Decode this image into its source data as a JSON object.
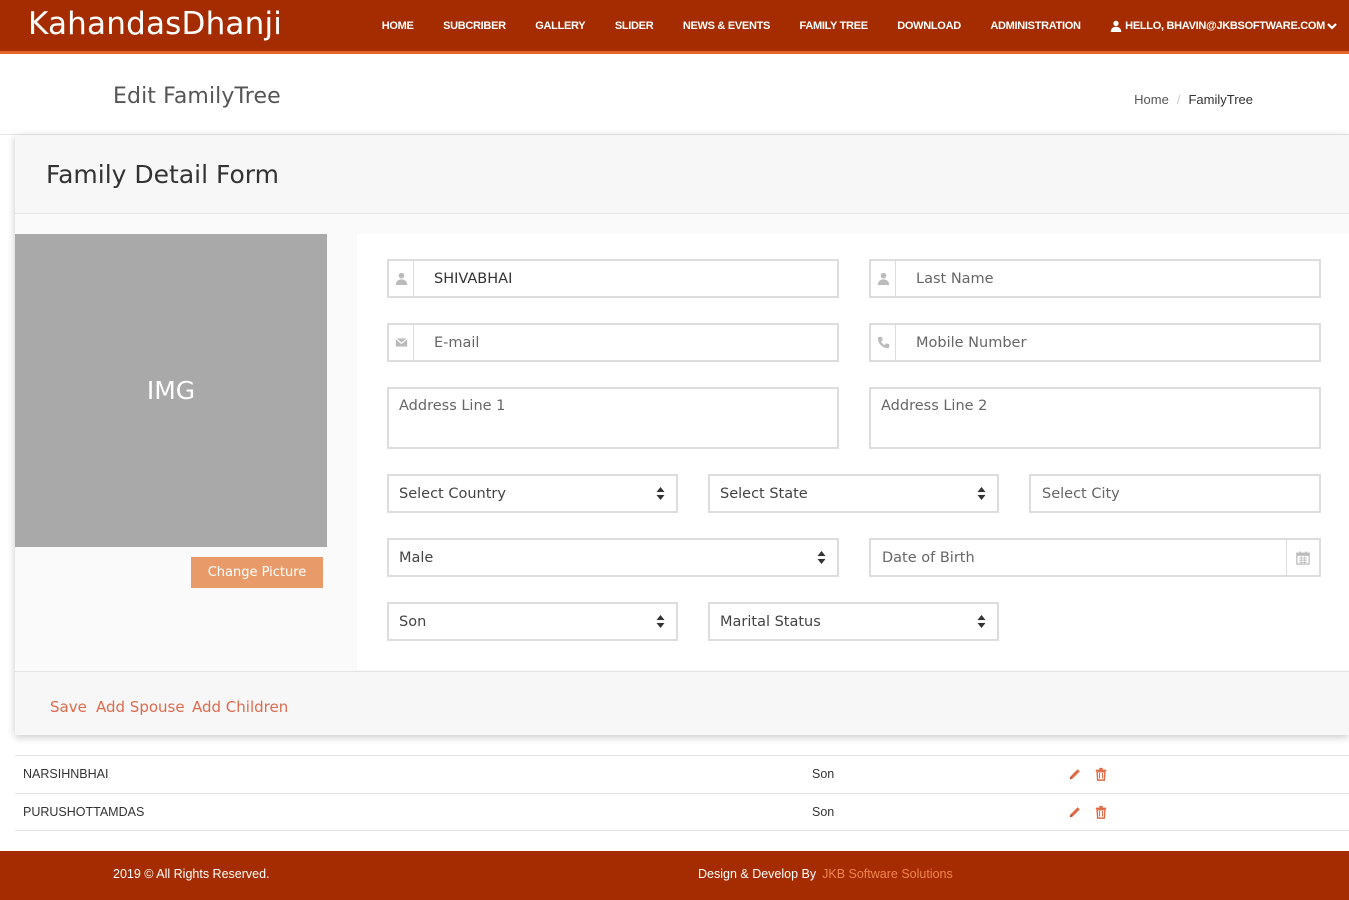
{
  "navbar": {
    "brand": "KahandasDhanji",
    "items": [
      "HOME",
      "SUBCRIBER",
      "GALLERY",
      "SLIDER",
      "NEWS & EVENTS",
      "FAMILY TREE",
      "DOWNLOAD",
      "ADMINISTRATION"
    ],
    "user_label": "HELLO, BHAVIN@JKBSOFTWARE.COM",
    "user_icon": "user-icon",
    "user_chevron_icon": "chevron-down-icon"
  },
  "page_header": {
    "title": "Edit FamilyTree",
    "breadcrumb": {
      "home": "Home",
      "separator": "/",
      "current": "FamilyTree"
    }
  },
  "form": {
    "title": "Family Detail Form",
    "photo_placeholder": "IMG",
    "change_picture": "Change Picture",
    "first_name": {
      "value": "SHIVABHAI",
      "icon": "user-icon"
    },
    "last_name": {
      "value": "",
      "placeholder": "Last Name",
      "icon": "user-icon"
    },
    "email": {
      "value": "",
      "placeholder": "E-mail",
      "icon": "envelope-icon"
    },
    "mobile": {
      "value": "",
      "placeholder": "Mobile Number",
      "icon": "phone-icon"
    },
    "address1": {
      "placeholder": "Address Line 1"
    },
    "address2": {
      "placeholder": "Address Line 2"
    },
    "country": "Select Country",
    "state": "Select State",
    "city": "Select City",
    "gender": "Male",
    "dob": {
      "placeholder": "Date of Birth",
      "icon": "calendar-icon"
    },
    "relation": "Son",
    "marital_status": "Marital Status"
  },
  "actions": {
    "save": "Save",
    "add_spouse": "Add Spouse",
    "add_children": "Add Children"
  },
  "members": [
    {
      "name": "NARSIHNBHAI",
      "relation": "Son"
    },
    {
      "name": "PURUSHOTTAMDAS",
      "relation": "Son"
    }
  ],
  "footer": {
    "copyright": "2019 © All Rights Reserved.",
    "credit_prefix": "Design & Develop By",
    "credit_link": "JKB Software Solutions"
  },
  "colors": {
    "primary": "#a42c00",
    "accent": "#e2652a",
    "button": "#e89b69",
    "link": "#de6a4e",
    "photo_bg": "#a9a9a9"
  }
}
